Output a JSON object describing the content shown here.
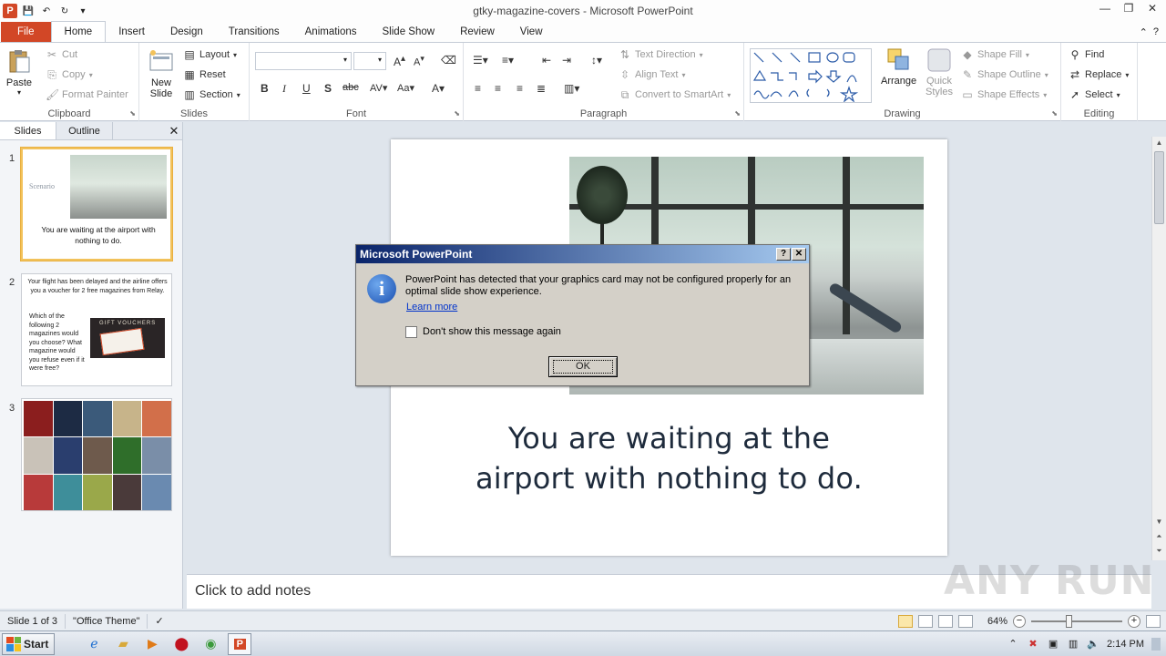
{
  "window": {
    "title": "gtky-magazine-covers - Microsoft PowerPoint",
    "controls": [
      "—",
      "❐",
      "✕"
    ]
  },
  "tabs": [
    "File",
    "Home",
    "Insert",
    "Design",
    "Transitions",
    "Animations",
    "Slide Show",
    "Review",
    "View"
  ],
  "active_tab": "Home",
  "ribbon": {
    "clipboard": {
      "label": "Clipboard",
      "paste": "Paste",
      "cut": "Cut",
      "copy": "Copy",
      "format_painter": "Format Painter"
    },
    "slides": {
      "label": "Slides",
      "new_slide": "New Slide",
      "layout": "Layout",
      "reset": "Reset",
      "section": "Section"
    },
    "font": {
      "label": "Font"
    },
    "paragraph": {
      "label": "Paragraph",
      "text_direction": "Text Direction",
      "align_text": "Align Text",
      "convert_smartart": "Convert to SmartArt"
    },
    "drawing": {
      "label": "Drawing",
      "arrange": "Arrange",
      "quick_styles": "Quick Styles",
      "shape_fill": "Shape Fill",
      "shape_outline": "Shape Outline",
      "shape_effects": "Shape Effects"
    },
    "editing": {
      "label": "Editing",
      "find": "Find",
      "replace": "Replace",
      "select": "Select"
    }
  },
  "panel": {
    "tabs": [
      "Slides",
      "Outline"
    ],
    "thumbnails": [
      {
        "num": "1",
        "scenario": "Scenario",
        "text": "You are waiting at the airport with nothing to do."
      },
      {
        "num": "2",
        "top": "Your flight has been delayed and the airline offers you a voucher for 2 free magazines from Relay.",
        "left": "Which of the following 2 magazines would you choose? What magazine would you refuse even if it were free?",
        "voucher": "GIFT VOUCHERS"
      },
      {
        "num": "3"
      }
    ]
  },
  "slide": {
    "caption_line1": "You are waiting at the",
    "caption_line2": "airport with nothing to do."
  },
  "notes": {
    "placeholder": "Click to add notes"
  },
  "watermark": "ANY RUN",
  "status": {
    "slide_of": "Slide 1 of 3",
    "theme": "\"Office Theme\"",
    "zoom": "64%"
  },
  "dialog": {
    "title": "Microsoft PowerPoint",
    "message": "PowerPoint has detected that your graphics card may not be configured properly for an optimal slide show experience.",
    "link": "Learn more",
    "checkbox_label": "Don't show this message again",
    "ok": "OK"
  },
  "taskbar": {
    "start": "Start",
    "clock": "2:14 PM"
  },
  "colors": {
    "file_tab": "#d24726",
    "dialog_title": "#0a246a",
    "selected_thumb": "#f2c25b"
  }
}
